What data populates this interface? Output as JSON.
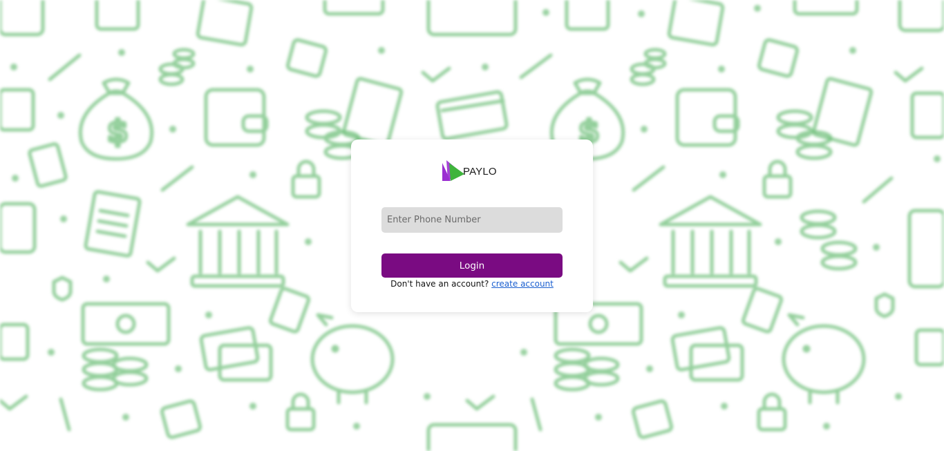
{
  "brand": {
    "name": "PAYLO",
    "logo_icon": "paylo-triangle-logo-icon",
    "logo_colors": [
      "#9b2fd1",
      "#3fb43c"
    ]
  },
  "login_form": {
    "phone_placeholder": "Enter Phone Number",
    "phone_value": "",
    "login_label": "Login",
    "signup_prompt": "Don't have an account?",
    "signup_link": "create account"
  },
  "theme": {
    "accent": "#7a0b82",
    "input_bg": "#dcdcdc",
    "link": "#1a5fd0",
    "pattern": "#6fbf7a"
  },
  "background_icons": [
    "money-bag-icon",
    "wallet-icon",
    "bank-icon",
    "coins-icon",
    "credit-card-icon",
    "calculator-icon",
    "piggy-bank-icon",
    "banknote-icon",
    "pen-icon",
    "checkmark-icon",
    "padlock-icon",
    "invoice-icon"
  ]
}
